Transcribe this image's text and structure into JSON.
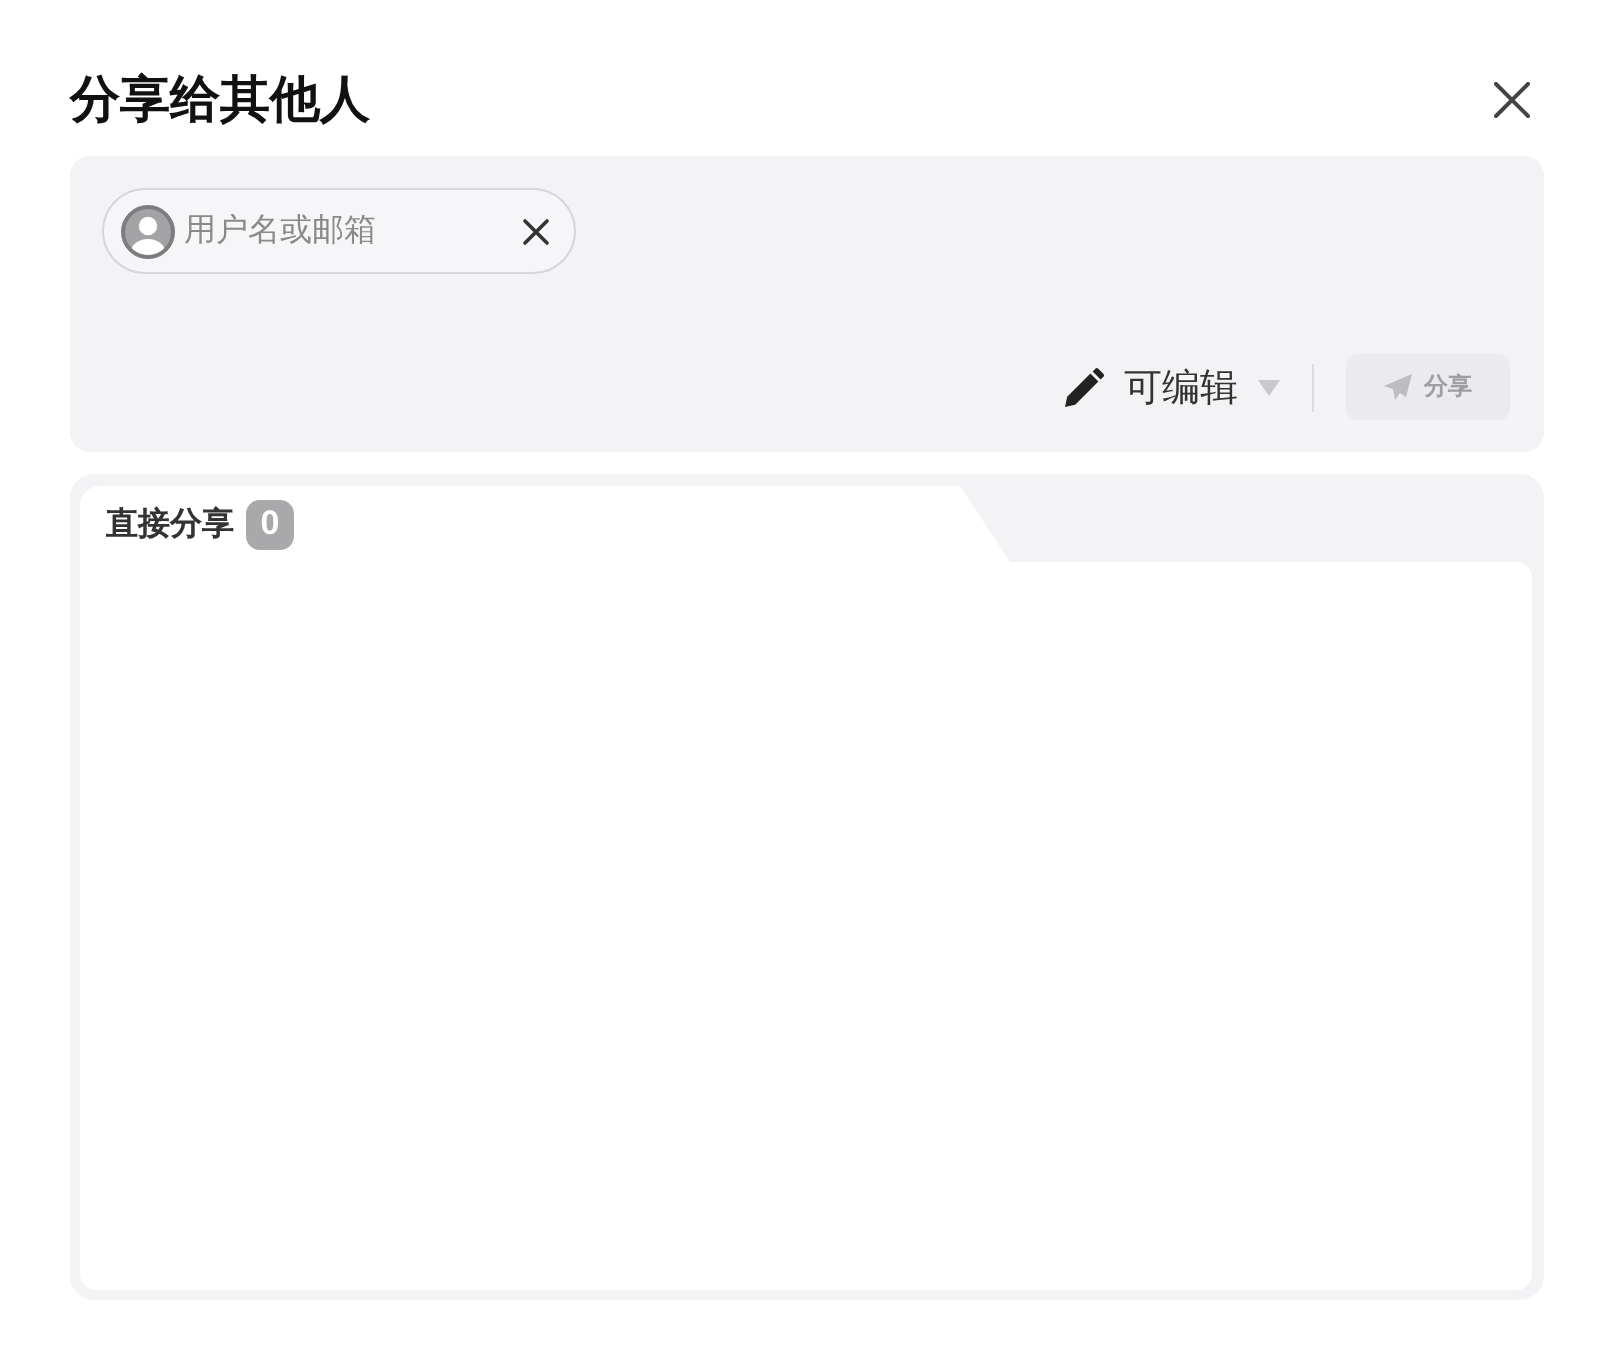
{
  "dialog": {
    "title": "分享给其他人"
  },
  "recipient_field": {
    "placeholder": "用户名或邮箱"
  },
  "permission": {
    "label": "可编辑"
  },
  "share_button": {
    "label": "分享",
    "disabled": true
  },
  "tabs": [
    {
      "label": "直接分享",
      "count": "0",
      "selected": true
    }
  ]
}
